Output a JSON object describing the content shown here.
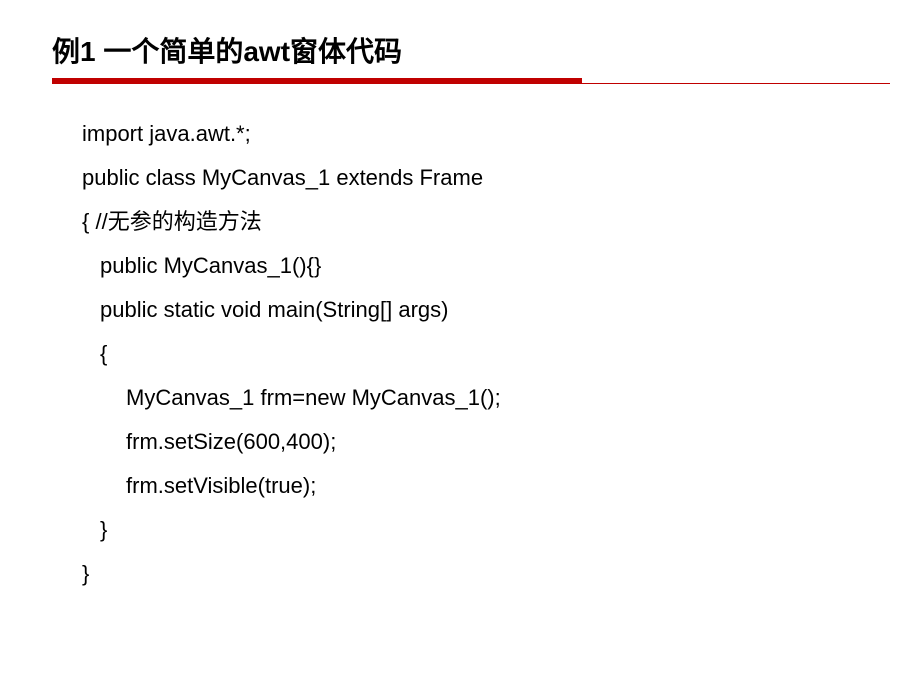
{
  "title": "例1 一个简单的awt窗体代码",
  "code": {
    "line1": "import java.awt.*;",
    "line2": "public class MyCanvas_1 extends Frame",
    "line3_open": "{ //",
    "line3_comment": "无参的构造方法",
    "line4": "public MyCanvas_1(){}",
    "line5": "public static void main(String[] args)",
    "line6": "{",
    "line7": "MyCanvas_1 frm=new MyCanvas_1();",
    "line8": "frm.setSize(600,400);",
    "line9": "frm.setVisible(true);",
    "line10": "}",
    "line11": "}"
  }
}
